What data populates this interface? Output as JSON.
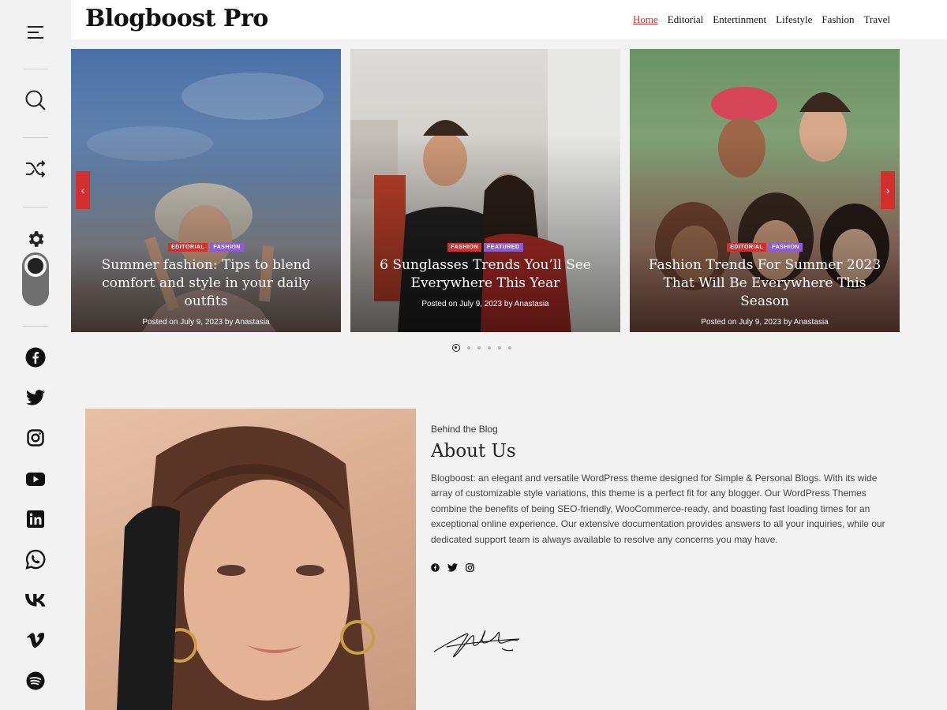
{
  "site": {
    "logo": "Blogboost Pro"
  },
  "nav": [
    {
      "label": "Home",
      "active": true
    },
    {
      "label": "Editorial"
    },
    {
      "label": "Entertinment"
    },
    {
      "label": "Lifestyle"
    },
    {
      "label": "Fashion"
    },
    {
      "label": "Travel"
    }
  ],
  "sidebar": {
    "icons": [
      "menu-icon",
      "search-icon",
      "shuffle-icon",
      "gear-icon",
      "theme-toggle"
    ],
    "social": [
      "facebook-icon",
      "twitter-icon",
      "instagram-icon",
      "youtube-icon",
      "linkedin-icon",
      "whatsapp-icon",
      "vk-icon",
      "vimeo-icon",
      "spotify-icon"
    ]
  },
  "slides": [
    {
      "tags": [
        "Editorial",
        "Fashion"
      ],
      "title": "Summer fashion: Tips to blend comfort and style in your daily outfits",
      "meta": "Posted on July 9, 2023 by Anastasia"
    },
    {
      "tags": [
        "Fashion",
        "Featured"
      ],
      "title": "6 Sunglasses Trends You’ll See Everywhere This Year",
      "meta": "Posted on July 9, 2023 by Anastasia"
    },
    {
      "tags": [
        "Editorial",
        "Fashion"
      ],
      "title": "Fashion Trends For Summer 2023 That Will Be Everywhere This Season",
      "meta": "Posted on July 9, 2023 by Anastasia"
    }
  ],
  "slider": {
    "prev": "‹",
    "next": "›",
    "dot_count": 6,
    "active_dot": 0
  },
  "about": {
    "eyebrow": "Behind the Blog",
    "title": "About Us",
    "body": "Blogboost: an elegant and versatile WordPress theme designed for Simple & Personal Blogs. With its wide array of customizable style variations, this theme is a perfect fit for any blogger. Our WordPress Themes combine the benefits of being SEO-friendly, WooCommerce-ready, and boasting fast loading times for an exceptional online experience. Our extensive documentation provides answers to all your inquiries, while our dedicated support team is always available to resolve any concerns you may have.",
    "social": [
      "facebook-icon",
      "twitter-icon",
      "instagram-icon"
    ]
  },
  "colors": {
    "accent": "#d32f2f",
    "tag_purple": "#8e5bd1",
    "background": "#f2f2f2"
  }
}
